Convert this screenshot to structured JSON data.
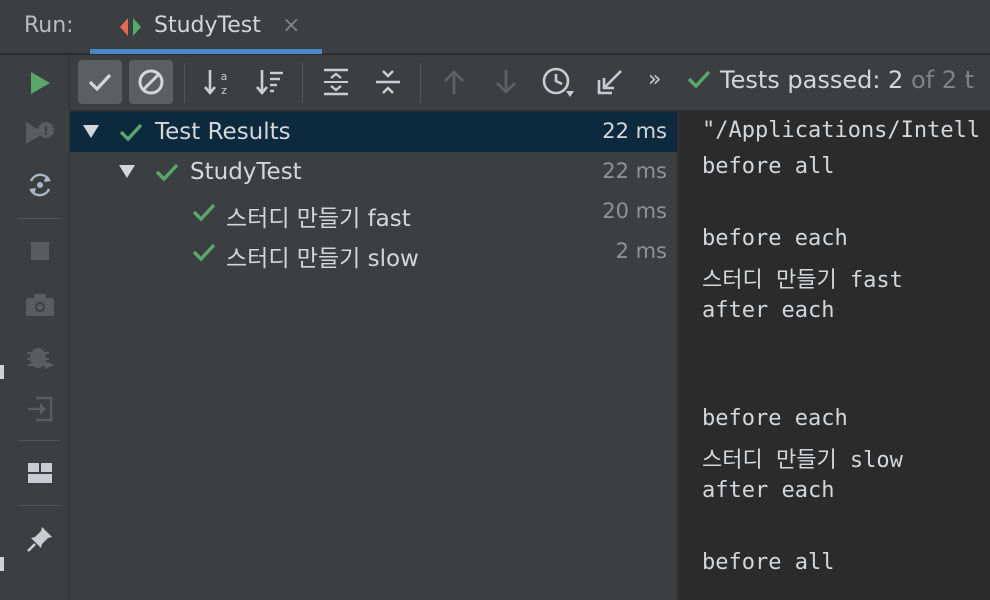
{
  "header": {
    "run_label": "Run:",
    "tab": {
      "label": "StudyTest",
      "close": "×",
      "icon": "run-config-icon"
    }
  },
  "left_toolbar": {
    "buttons": [
      "rerun-icon",
      "rerun-failed-icon",
      "toggle-auto-test-icon",
      "stop-icon",
      "camera-icon",
      "debug-icon",
      "exit-icon",
      "layout-icon",
      "pin-icon"
    ]
  },
  "toolbar": {
    "buttons": [
      "show-passed-icon",
      "show-ignored-icon",
      "sort-alphabetically-icon",
      "sort-by-duration-icon",
      "expand-all-icon",
      "collapse-all-icon",
      "previous-test-icon",
      "next-test-icon",
      "test-history-icon",
      "import-tests-icon",
      "more-icon"
    ],
    "more": "»",
    "status": {
      "passed_text": "Tests passed: 2",
      "total_text": " of 2 t"
    }
  },
  "tree": {
    "rows": [
      {
        "label": "Test Results",
        "duration": "22 ms"
      },
      {
        "label": "StudyTest",
        "duration": "22 ms"
      },
      {
        "label": "스터디 만들기 fast",
        "duration": "20 ms"
      },
      {
        "label": "스터디 만들기 slow",
        "duration": "2 ms"
      }
    ]
  },
  "console": {
    "lines": [
      "\"/Applications/Intell",
      "before all",
      "",
      "before each",
      "스터디 만들기 fast",
      "after each",
      "",
      "",
      "before each",
      "스터디 만들기 slow",
      "after each",
      "",
      "before all"
    ]
  },
  "colors": {
    "accent": "#4a88c7",
    "pass_green": "#59a869",
    "selection": "#0d293e",
    "panel": "#3c3f41",
    "console_bg": "#2b2b2b"
  }
}
